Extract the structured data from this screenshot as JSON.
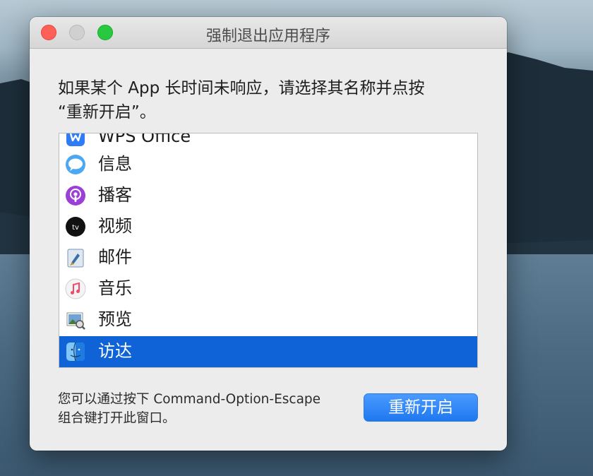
{
  "window": {
    "title": "强制退出应用程序",
    "prompt_line1": "如果某个 App 长时间未响应，请选择其名称并点按",
    "prompt_line2": "“重新开启”。"
  },
  "apps": [
    {
      "label": "WPS Office",
      "icon": "wps-office-icon"
    },
    {
      "label": "信息",
      "icon": "messages-icon"
    },
    {
      "label": "播客",
      "icon": "podcasts-icon"
    },
    {
      "label": "视频",
      "icon": "apple-tv-icon"
    },
    {
      "label": "邮件",
      "icon": "mail-icon"
    },
    {
      "label": "音乐",
      "icon": "music-icon"
    },
    {
      "label": "预览",
      "icon": "preview-icon"
    },
    {
      "label": "访达",
      "icon": "finder-icon",
      "selected": true
    }
  ],
  "footer": {
    "hint_line1": "您可以通过按下 Command-Option-Escape",
    "hint_line2": "组合键打开此窗口。",
    "relaunch_label": "重新开启"
  },
  "colors": {
    "selection": "#0f63d6",
    "button": "#1f78f0",
    "close": "#fe5f57",
    "maximize": "#28c840"
  }
}
